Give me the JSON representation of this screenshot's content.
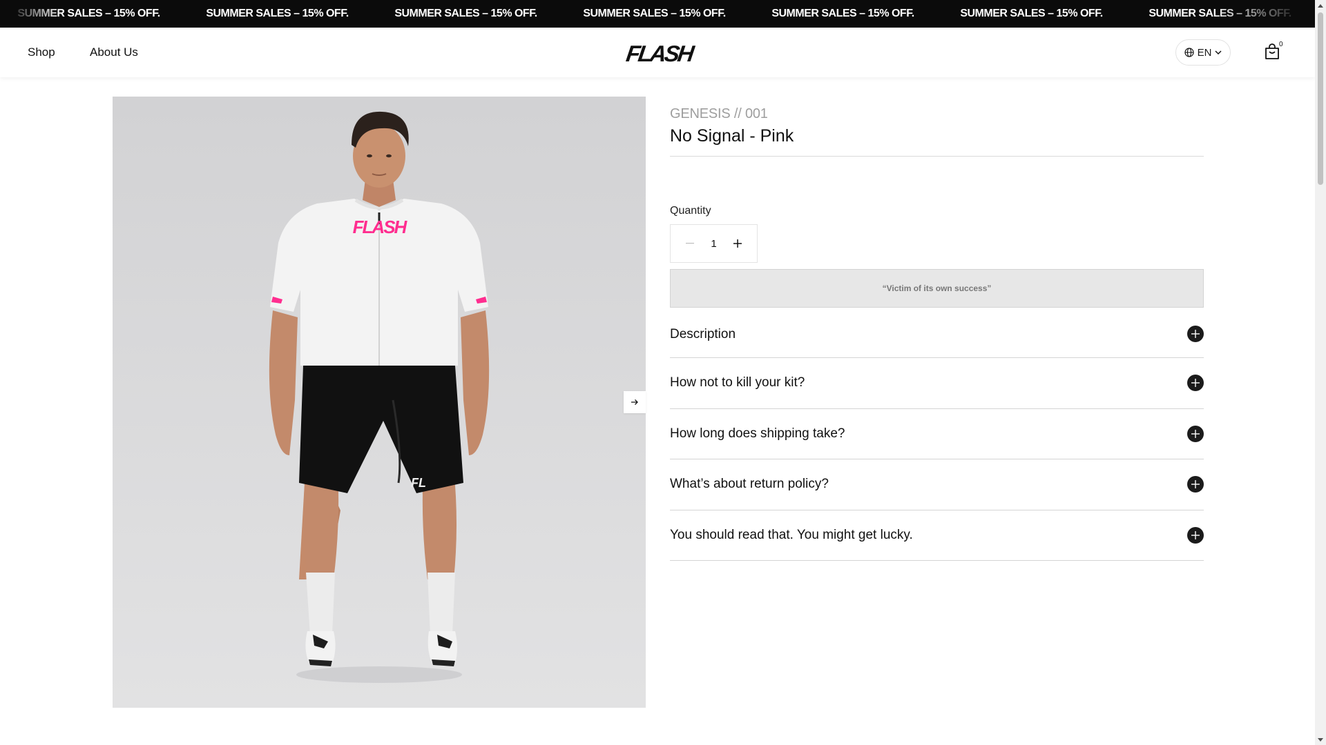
{
  "announcement": {
    "items": [
      "SUMMER SALES – 15% OFF.",
      "SUMMER SALES – 15% OFF.",
      "SUMMER SALES – 15% OFF.",
      "SUMMER SALES – 15% OFF.",
      "SUMMER SALES – 15% OFF.",
      "SUMMER SALES – 15% OFF.",
      "SUMMER SALES – 15% OFF.",
      "SUMMER SALES – 15% OFF."
    ]
  },
  "header": {
    "nav": [
      {
        "label": "Shop"
      },
      {
        "label": "About Us"
      }
    ],
    "logo_text": "FLASH",
    "language": "EN",
    "cart_count": "0"
  },
  "product": {
    "collection": "GENESIS // 001",
    "title": "No Signal - Pink",
    "quantity_label": "Quantity",
    "quantity": "1",
    "soldout_message": "“Victim of its own success”",
    "accordion": [
      {
        "label": "Description"
      },
      {
        "label": "How not to kill your kit?"
      },
      {
        "label": "How long does shipping take?"
      },
      {
        "label": "What’s about return policy?"
      },
      {
        "label": "You should read that. You might get lucky."
      }
    ]
  },
  "colors": {
    "announcement_bg": "#0b0b0b",
    "brand_pink": "#ff2d8f",
    "accent_dark": "#1b1b1b"
  }
}
